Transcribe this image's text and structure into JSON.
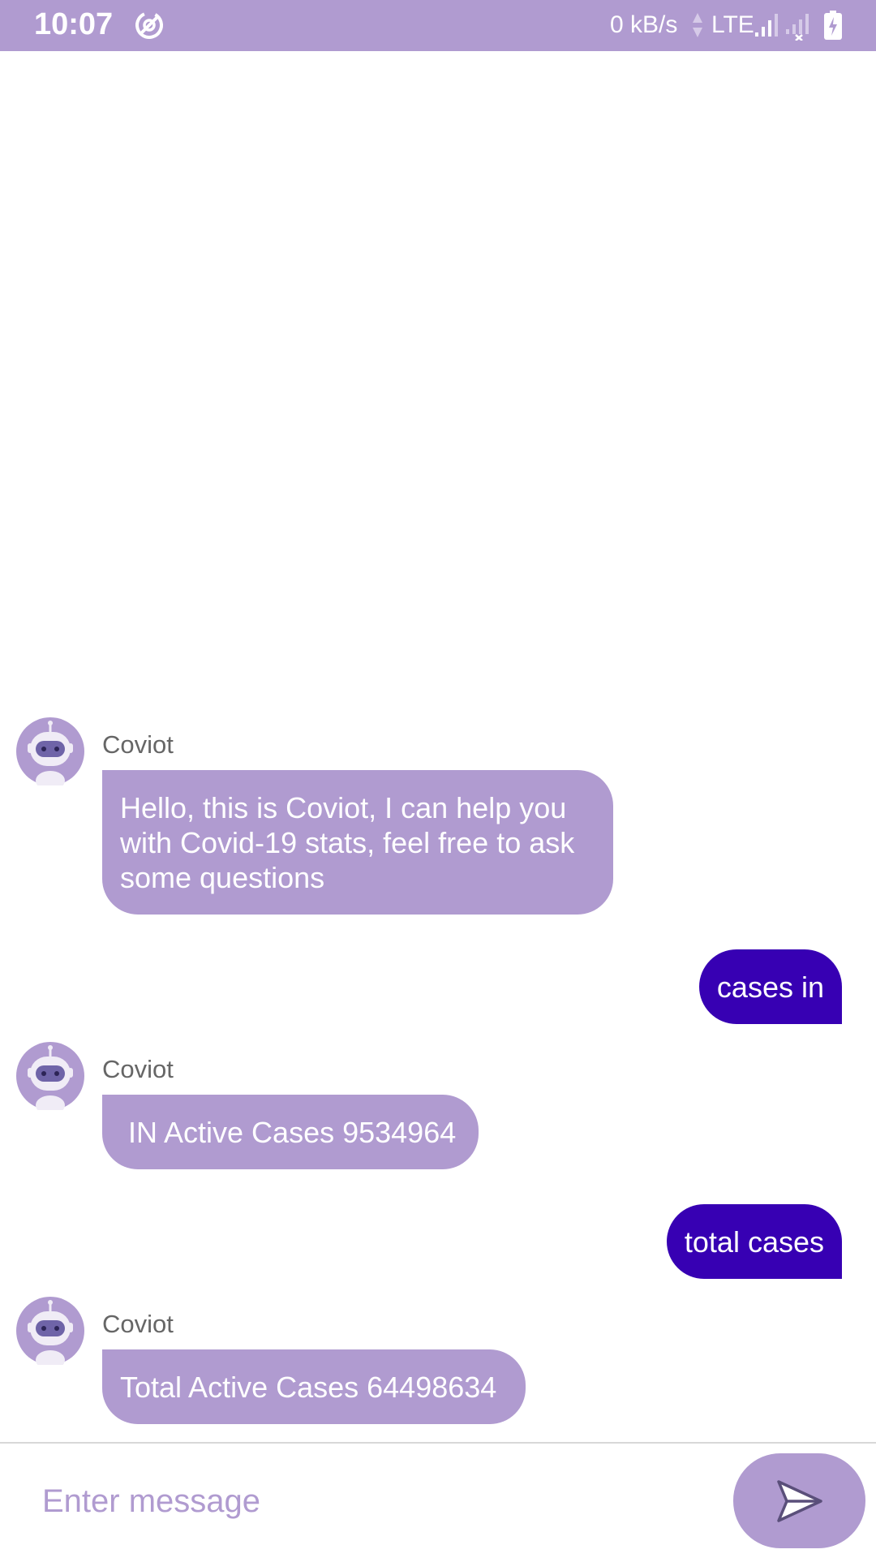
{
  "status_bar": {
    "time": "10:07",
    "network_speed": "0 kB/s",
    "network_type": "LTE"
  },
  "chat": {
    "messages": [
      {
        "sender": "bot",
        "name": "Coviot",
        "text": "Hello, this is Coviot, I can help you with Covid-19 stats, feel free to ask some questions"
      },
      {
        "sender": "user",
        "text": "cases in"
      },
      {
        "sender": "bot",
        "name": "Coviot",
        "text": " IN Active Cases 9534964"
      },
      {
        "sender": "user",
        "text": "total cases"
      },
      {
        "sender": "bot",
        "name": "Coviot",
        "text": "Total Active Cases 64498634"
      }
    ]
  },
  "input": {
    "placeholder": "Enter message",
    "value": ""
  },
  "icons": {
    "app_status": "data-saver-icon",
    "send": "send-icon",
    "avatar": "robot-avatar-icon"
  },
  "colors": {
    "primary_light": "#b09bd0",
    "user_bubble": "#3700b3",
    "bot_name": "#666666"
  }
}
